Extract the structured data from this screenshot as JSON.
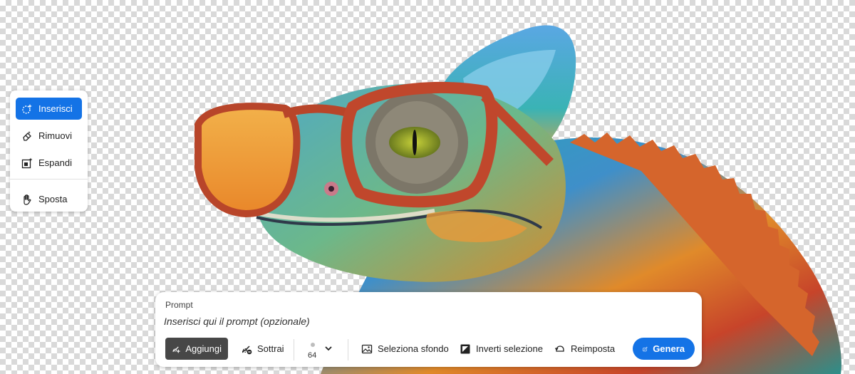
{
  "tools": {
    "items": [
      {
        "label": "Inserisci",
        "icon": "generative-fill-icon",
        "active": true
      },
      {
        "label": "Rimuovi",
        "icon": "eraser-icon",
        "active": false
      },
      {
        "label": "Espandi",
        "icon": "expand-icon",
        "active": false
      },
      {
        "label": "Sposta",
        "icon": "hand-icon",
        "active": false
      }
    ]
  },
  "prompt": {
    "label": "Prompt",
    "placeholder": "Inserisci qui il prompt (opzionale)",
    "value": ""
  },
  "toolbar": {
    "add_label": "Aggiungi",
    "subtract_label": "Sottrai",
    "brush_size": "64",
    "select_bg_label": "Seleziona sfondo",
    "invert_label": "Inverti selezione",
    "reset_label": "Reimposta",
    "generate_label": "Genera"
  },
  "colors": {
    "accent": "#1473e6",
    "add_button": "#474747",
    "checker": "#d9d9d9"
  }
}
